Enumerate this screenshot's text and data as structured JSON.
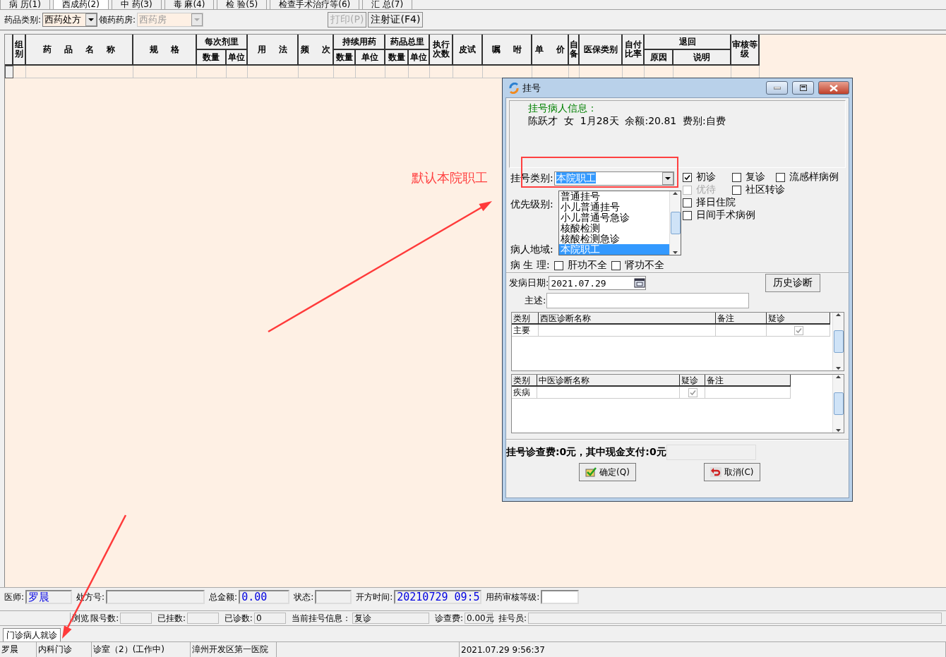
{
  "tabs": [
    {
      "label": "病 历(1)",
      "selected": false
    },
    {
      "label": "西成药(2)",
      "selected": true
    },
    {
      "label": "中 药(3)",
      "selected": false
    },
    {
      "label": "毒 麻(4)",
      "selected": false
    },
    {
      "label": "检 验(5)",
      "selected": false
    },
    {
      "label": "检查手术治疗等(6)",
      "selected": false
    },
    {
      "label": "汇 总(7)",
      "selected": false
    }
  ],
  "toolbar": {
    "category": {
      "label": "药品类别:",
      "value": "西药处方",
      "disabled": false
    },
    "pharmacy": {
      "label": "领药药房:",
      "value": "西药房",
      "disabled": true
    },
    "buttons": [
      {
        "label": "打印(P)",
        "disabled": true
      },
      {
        "label": "注射证(F4)",
        "disabled": false
      }
    ]
  },
  "grid": {
    "columns": [
      {
        "label": "组别"
      },
      {
        "label": "药 品 名 称"
      },
      {
        "label": "规 格"
      },
      {
        "group": "每次剂里",
        "children": [
          "数量",
          "单位"
        ]
      },
      {
        "label": "用 法"
      },
      {
        "label": "频 次"
      },
      {
        "group": "持续用药",
        "children": [
          "数量",
          "单位"
        ]
      },
      {
        "group": "药品总里",
        "children": [
          "数量",
          "单位"
        ]
      },
      {
        "label": "执行次数"
      },
      {
        "label": "皮试"
      },
      {
        "label": "嘱 咐"
      },
      {
        "label": "单 价"
      },
      {
        "label": "自备"
      },
      {
        "label": "医保类别"
      },
      {
        "label": "自付比率"
      },
      {
        "group": "退回",
        "children": [
          "原因",
          "说明"
        ]
      },
      {
        "label": "审核等级"
      }
    ]
  },
  "dialog": {
    "title": "挂号",
    "info_title": "挂号病人信息：",
    "info_line": "陈跃才  女  1月28天  余额:20.81  费别:自费",
    "reg_type": {
      "label": "挂号类别:",
      "value": "本院职工"
    },
    "priority_label": "优先级别:",
    "region_label": "病人地域:",
    "dropdown_options": [
      {
        "label": "普通挂号",
        "selected": false
      },
      {
        "label": "小儿普通挂号",
        "selected": false
      },
      {
        "label": "小儿普通号急诊",
        "selected": false
      },
      {
        "label": "核酸检测",
        "selected": false
      },
      {
        "label": "核酸检测急诊",
        "selected": false
      },
      {
        "label": "本院职工",
        "selected": true
      }
    ],
    "check_rows": [
      [
        {
          "label": "初诊",
          "checked": true,
          "disabled": false
        },
        {
          "label": "复诊",
          "checked": false,
          "disabled": false
        },
        {
          "label": "流感样病例",
          "checked": false,
          "disabled": false
        }
      ],
      [
        {
          "label": "优待",
          "checked": false,
          "disabled": true
        },
        {
          "label": "社区转诊",
          "checked": false,
          "disabled": false
        }
      ],
      [
        {
          "label": "择日住院",
          "checked": false,
          "disabled": false
        }
      ],
      [
        {
          "label": "日间手术病例",
          "checked": false,
          "disabled": false
        }
      ]
    ],
    "physiology": {
      "label": "病 生 理:",
      "options": [
        {
          "label": "肝功不全",
          "checked": false
        },
        {
          "label": "肾功不全",
          "checked": false
        }
      ]
    },
    "onset": {
      "label": "发病日期:",
      "value": "2021.07.29"
    },
    "history_button": "历史诊断",
    "complaint_label": "主述:",
    "western_table": {
      "columns": [
        "类别",
        "西医诊断名称",
        "备注",
        "疑诊"
      ],
      "rows": [
        {
          "category": "主要",
          "suspected": true
        }
      ]
    },
    "chinese_table": {
      "columns": [
        "类别",
        "中医诊断名称",
        "疑诊",
        "备注"
      ],
      "rows": [
        {
          "category": "疾病",
          "suspected": true
        }
      ]
    },
    "fee_text": "挂号诊查费:0元，其中现金支付:0元",
    "buttons": [
      {
        "label": "确定(Q)",
        "kind": "ok"
      },
      {
        "label": "取消(C)",
        "kind": "cancel"
      }
    ]
  },
  "annotation": {
    "note": "默认本院职工"
  },
  "bottom_fields": [
    {
      "label": "医师:",
      "value": "罗晨"
    },
    {
      "label": "处方号:"
    },
    {
      "label": "总金额:",
      "value": "0.00"
    },
    {
      "label": "状态:"
    },
    {
      "label": "开方时间:",
      "value": "20210729 09:5"
    },
    {
      "label": "用药审核等级:"
    }
  ],
  "info_row": [
    {
      "label": "浏览"
    },
    {
      "label": "限号数:"
    },
    {
      "label": "已挂数:"
    },
    {
      "label": "已诊数:",
      "value": "0"
    },
    {
      "label": "当前挂号信息：",
      "value": "复诊"
    },
    {
      "label": "诊查费:",
      "value": "0.00元"
    },
    {
      "label": "挂号员:"
    }
  ],
  "bottom_tab": {
    "label": "门诊病人就诊",
    "selected": true
  },
  "status_bar": [
    "罗晨",
    "内科门诊",
    "诊室（2）(工作中)",
    "漳州开发区第一医院",
    "2021.07.29 9:56:37"
  ]
}
